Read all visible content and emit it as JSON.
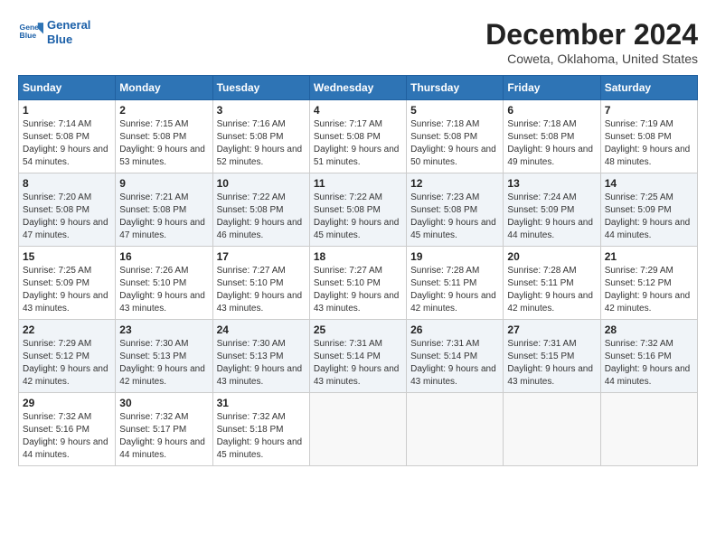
{
  "logo": {
    "line1": "General",
    "line2": "Blue"
  },
  "title": "December 2024",
  "subtitle": "Coweta, Oklahoma, United States",
  "headers": [
    "Sunday",
    "Monday",
    "Tuesday",
    "Wednesday",
    "Thursday",
    "Friday",
    "Saturday"
  ],
  "weeks": [
    [
      {
        "day": "1",
        "sunrise": "7:14 AM",
        "sunset": "5:08 PM",
        "daylight": "9 hours and 54 minutes."
      },
      {
        "day": "2",
        "sunrise": "7:15 AM",
        "sunset": "5:08 PM",
        "daylight": "9 hours and 53 minutes."
      },
      {
        "day": "3",
        "sunrise": "7:16 AM",
        "sunset": "5:08 PM",
        "daylight": "9 hours and 52 minutes."
      },
      {
        "day": "4",
        "sunrise": "7:17 AM",
        "sunset": "5:08 PM",
        "daylight": "9 hours and 51 minutes."
      },
      {
        "day": "5",
        "sunrise": "7:18 AM",
        "sunset": "5:08 PM",
        "daylight": "9 hours and 50 minutes."
      },
      {
        "day": "6",
        "sunrise": "7:18 AM",
        "sunset": "5:08 PM",
        "daylight": "9 hours and 49 minutes."
      },
      {
        "day": "7",
        "sunrise": "7:19 AM",
        "sunset": "5:08 PM",
        "daylight": "9 hours and 48 minutes."
      }
    ],
    [
      {
        "day": "8",
        "sunrise": "7:20 AM",
        "sunset": "5:08 PM",
        "daylight": "9 hours and 47 minutes."
      },
      {
        "day": "9",
        "sunrise": "7:21 AM",
        "sunset": "5:08 PM",
        "daylight": "9 hours and 47 minutes."
      },
      {
        "day": "10",
        "sunrise": "7:22 AM",
        "sunset": "5:08 PM",
        "daylight": "9 hours and 46 minutes."
      },
      {
        "day": "11",
        "sunrise": "7:22 AM",
        "sunset": "5:08 PM",
        "daylight": "9 hours and 45 minutes."
      },
      {
        "day": "12",
        "sunrise": "7:23 AM",
        "sunset": "5:08 PM",
        "daylight": "9 hours and 45 minutes."
      },
      {
        "day": "13",
        "sunrise": "7:24 AM",
        "sunset": "5:09 PM",
        "daylight": "9 hours and 44 minutes."
      },
      {
        "day": "14",
        "sunrise": "7:25 AM",
        "sunset": "5:09 PM",
        "daylight": "9 hours and 44 minutes."
      }
    ],
    [
      {
        "day": "15",
        "sunrise": "7:25 AM",
        "sunset": "5:09 PM",
        "daylight": "9 hours and 43 minutes."
      },
      {
        "day": "16",
        "sunrise": "7:26 AM",
        "sunset": "5:10 PM",
        "daylight": "9 hours and 43 minutes."
      },
      {
        "day": "17",
        "sunrise": "7:27 AM",
        "sunset": "5:10 PM",
        "daylight": "9 hours and 43 minutes."
      },
      {
        "day": "18",
        "sunrise": "7:27 AM",
        "sunset": "5:10 PM",
        "daylight": "9 hours and 43 minutes."
      },
      {
        "day": "19",
        "sunrise": "7:28 AM",
        "sunset": "5:11 PM",
        "daylight": "9 hours and 42 minutes."
      },
      {
        "day": "20",
        "sunrise": "7:28 AM",
        "sunset": "5:11 PM",
        "daylight": "9 hours and 42 minutes."
      },
      {
        "day": "21",
        "sunrise": "7:29 AM",
        "sunset": "5:12 PM",
        "daylight": "9 hours and 42 minutes."
      }
    ],
    [
      {
        "day": "22",
        "sunrise": "7:29 AM",
        "sunset": "5:12 PM",
        "daylight": "9 hours and 42 minutes."
      },
      {
        "day": "23",
        "sunrise": "7:30 AM",
        "sunset": "5:13 PM",
        "daylight": "9 hours and 42 minutes."
      },
      {
        "day": "24",
        "sunrise": "7:30 AM",
        "sunset": "5:13 PM",
        "daylight": "9 hours and 43 minutes."
      },
      {
        "day": "25",
        "sunrise": "7:31 AM",
        "sunset": "5:14 PM",
        "daylight": "9 hours and 43 minutes."
      },
      {
        "day": "26",
        "sunrise": "7:31 AM",
        "sunset": "5:14 PM",
        "daylight": "9 hours and 43 minutes."
      },
      {
        "day": "27",
        "sunrise": "7:31 AM",
        "sunset": "5:15 PM",
        "daylight": "9 hours and 43 minutes."
      },
      {
        "day": "28",
        "sunrise": "7:32 AM",
        "sunset": "5:16 PM",
        "daylight": "9 hours and 44 minutes."
      }
    ],
    [
      {
        "day": "29",
        "sunrise": "7:32 AM",
        "sunset": "5:16 PM",
        "daylight": "9 hours and 44 minutes."
      },
      {
        "day": "30",
        "sunrise": "7:32 AM",
        "sunset": "5:17 PM",
        "daylight": "9 hours and 44 minutes."
      },
      {
        "day": "31",
        "sunrise": "7:32 AM",
        "sunset": "5:18 PM",
        "daylight": "9 hours and 45 minutes."
      },
      null,
      null,
      null,
      null
    ]
  ],
  "labels": {
    "sunrise": "Sunrise:",
    "sunset": "Sunset:",
    "daylight": "Daylight:"
  }
}
